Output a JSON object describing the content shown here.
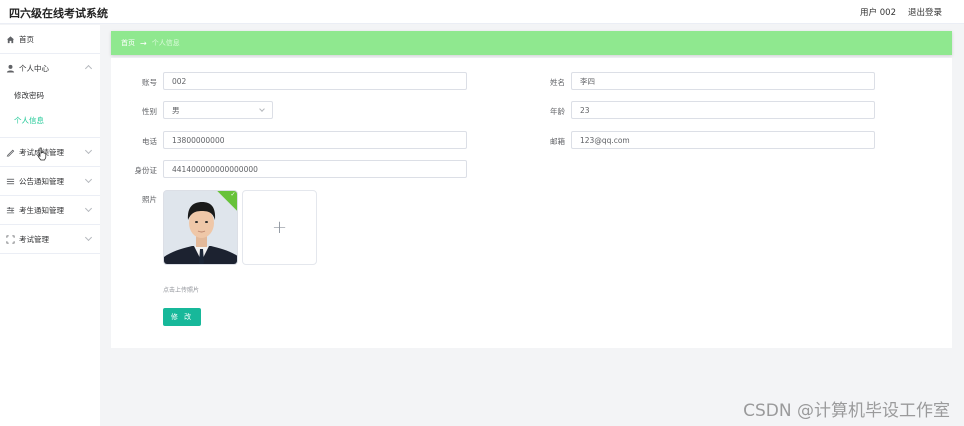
{
  "header": {
    "title": "四六级在线考试系统",
    "user_label": "用户 002",
    "logout_label": "退出登录"
  },
  "sidebar": {
    "items": [
      {
        "label": "首页",
        "icon": "home-icon"
      },
      {
        "label": "个人中心",
        "icon": "user-icon",
        "expanded": true,
        "children": [
          {
            "label": "修改密码"
          },
          {
            "label": "个人信息",
            "active": true
          }
        ]
      },
      {
        "label": "考试成绩管理",
        "icon": "score-icon"
      },
      {
        "label": "公告通知管理",
        "icon": "list-icon"
      },
      {
        "label": "考生通知管理",
        "icon": "sliders-icon"
      },
      {
        "label": "考试管理",
        "icon": "exam-icon"
      }
    ]
  },
  "breadcrumb": {
    "home": "首页",
    "separator": "→",
    "current": "个人信息"
  },
  "form": {
    "account": {
      "label": "账号",
      "value": "002"
    },
    "name": {
      "label": "姓名",
      "value": "李四"
    },
    "gender": {
      "label": "性别",
      "value": "男"
    },
    "age": {
      "label": "年龄",
      "value": "23"
    },
    "phone": {
      "label": "电话",
      "value": "13800000000"
    },
    "email": {
      "label": "邮箱",
      "value": "123@qq.com"
    },
    "id_card": {
      "label": "身份证",
      "value": "441400000000000000"
    },
    "photo": {
      "label": "照片",
      "upload_tip": "点击上传照片",
      "upload_plus": "+"
    },
    "submit_label": "修 改"
  },
  "watermark": "CSDN @计算机毕设工作室",
  "colors": {
    "accent": "#20c997",
    "breadcrumb_bg": "#8fe88f",
    "button_bg": "#17b89a"
  }
}
